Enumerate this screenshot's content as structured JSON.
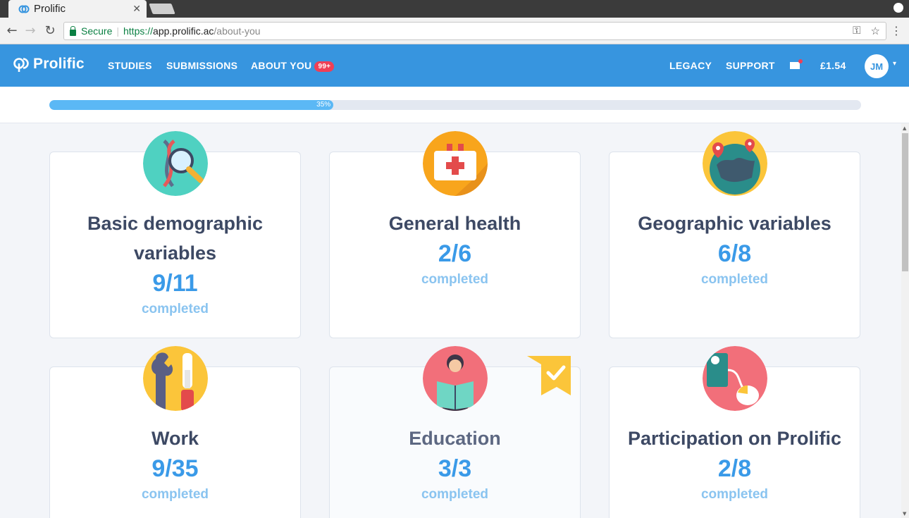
{
  "browser": {
    "tab_title": "Prolific",
    "secure_label": "Secure",
    "url_scheme": "https://",
    "url_host": "app.prolific.ac",
    "url_path": "/about-you"
  },
  "header": {
    "brand": "Prolific",
    "nav": {
      "studies": "STUDIES",
      "submissions": "SUBMISSIONS",
      "about_you": "ABOUT YOU",
      "about_you_badge": "99+",
      "legacy": "LEGACY",
      "support": "SUPPORT"
    },
    "balance": "£1.54",
    "avatar_initials": "JM"
  },
  "progress": {
    "percent": 35,
    "label": "35%"
  },
  "completed_label": "completed",
  "categories": [
    {
      "title": "Basic demographic variables",
      "count": "9/11",
      "icon": "dna-magnifier-icon"
    },
    {
      "title": "General health",
      "count": "2/6",
      "icon": "first-aid-kit-icon"
    },
    {
      "title": "Geographic variables",
      "count": "6/8",
      "icon": "globe-pins-icon"
    },
    {
      "title": "Work",
      "count": "9/35",
      "icon": "tools-icon"
    },
    {
      "title": "Education",
      "count": "3/3",
      "icon": "student-reading-icon",
      "complete": true
    },
    {
      "title": "Participation on Prolific",
      "count": "2/8",
      "icon": "computer-mouse-icon"
    }
  ],
  "colors": {
    "header_blue": "#3795df",
    "count_blue": "#3a9ae8",
    "completed_blue": "#8ac4f0",
    "title_navy": "#3d4964",
    "badge_red": "#ef3f56"
  }
}
